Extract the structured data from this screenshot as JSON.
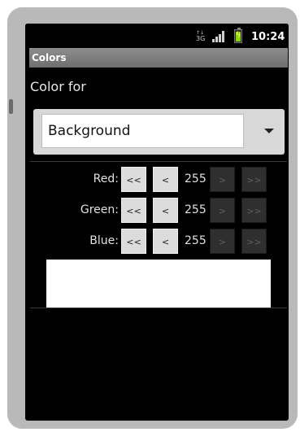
{
  "status_bar": {
    "network_icon": "3g-data-icon",
    "network_text": "3G",
    "signal_icon": "signal-bars-icon",
    "battery_icon": "battery-charging-icon",
    "time": "10:24"
  },
  "title_bar": {
    "title": "Colors"
  },
  "color_for": {
    "label": "Color for",
    "selected": "Background"
  },
  "channels": [
    {
      "label": "Red:",
      "value": "255",
      "btn_big_dec": "<<",
      "btn_dec": "<",
      "btn_inc": ">",
      "btn_big_inc": ">>"
    },
    {
      "label": "Green:",
      "value": "255",
      "btn_big_dec": "<<",
      "btn_dec": "<",
      "btn_inc": ">",
      "btn_big_inc": ">>"
    },
    {
      "label": "Blue:",
      "value": "255",
      "btn_big_dec": "<<",
      "btn_dec": "<",
      "btn_inc": ">",
      "btn_big_inc": ">>"
    }
  ],
  "preview_color": "#ffffff"
}
